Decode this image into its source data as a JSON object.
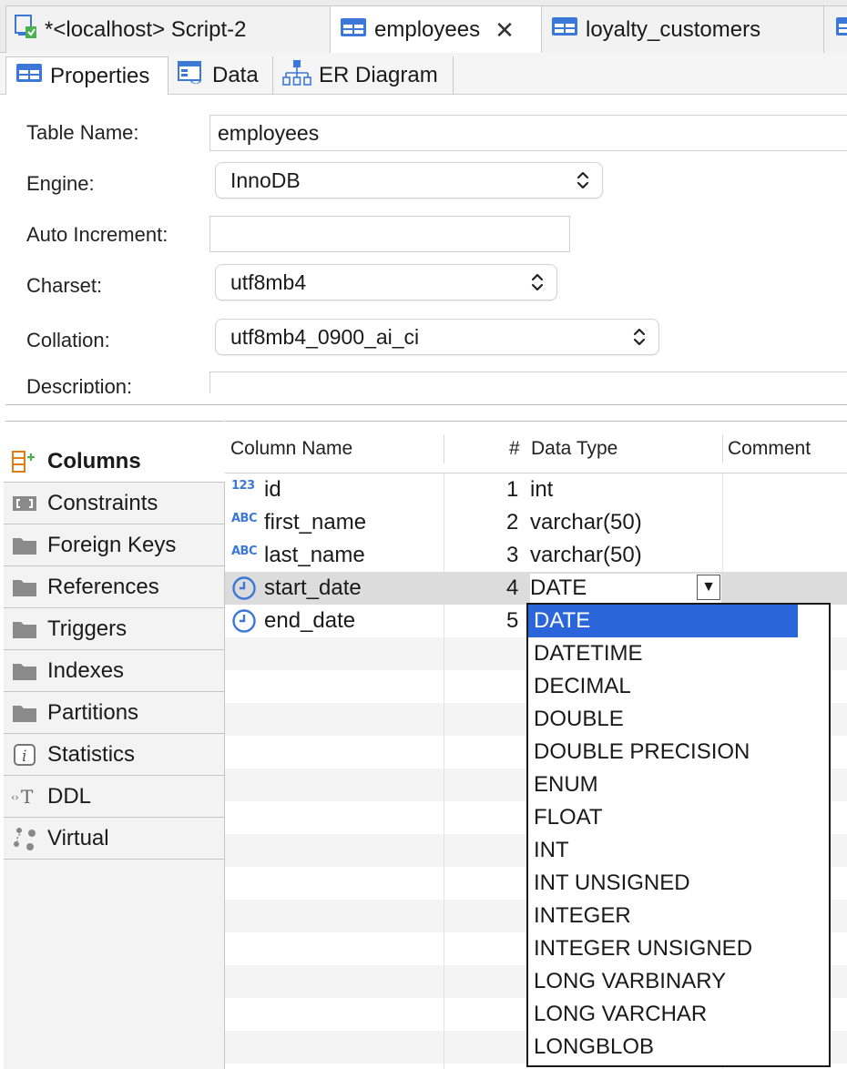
{
  "editor_tabs": [
    {
      "label": "*<localhost> Script-2"
    },
    {
      "label": "employees",
      "close": "✕"
    },
    {
      "label": "loyalty_customers"
    }
  ],
  "sub_tabs": [
    "Properties",
    "Data",
    "ER Diagram"
  ],
  "form": {
    "table_name_label": "Table Name:",
    "table_name_value": "employees",
    "engine_label": "Engine:",
    "engine_value": "InnoDB",
    "auto_increment_label": "Auto Increment:",
    "auto_increment_value": "",
    "charset_label": "Charset:",
    "charset_value": "utf8mb4",
    "collation_label": "Collation:",
    "collation_value": "utf8mb4_0900_ai_ci",
    "description_label": "Description:"
  },
  "nav": [
    "Columns",
    "Constraints",
    "Foreign Keys",
    "References",
    "Triggers",
    "Indexes",
    "Partitions",
    "Statistics",
    "DDL",
    "Virtual"
  ],
  "grid": {
    "headers": {
      "name": "Column Name",
      "num": "#",
      "type": "Data Type",
      "comment": "Comment"
    },
    "rows": [
      {
        "badge": "123",
        "name": "id",
        "num": "1",
        "type": "int"
      },
      {
        "badge": "ABC",
        "name": "first_name",
        "num": "2",
        "type": "varchar(50)"
      },
      {
        "badge": "ABC",
        "name": "last_name",
        "num": "3",
        "type": "varchar(50)"
      },
      {
        "badge": "clock",
        "name": "start_date",
        "num": "4",
        "type": "DATE",
        "dropdown_arrow": "▼"
      },
      {
        "badge": "clock",
        "name": "end_date",
        "num": "5",
        "type": ""
      }
    ]
  },
  "dropdown_options": [
    "DATE",
    "DATETIME",
    "DECIMAL",
    "DOUBLE",
    "DOUBLE PRECISION",
    "ENUM",
    "FLOAT",
    "INT",
    "INT UNSIGNED",
    "INTEGER",
    "INTEGER UNSIGNED",
    "LONG VARBINARY",
    "LONG VARCHAR",
    "LONGBLOB"
  ],
  "colors": {
    "accent": "#2a66d9",
    "icon_blue": "#3c78d8",
    "selected_row": "#dcdcdc"
  }
}
